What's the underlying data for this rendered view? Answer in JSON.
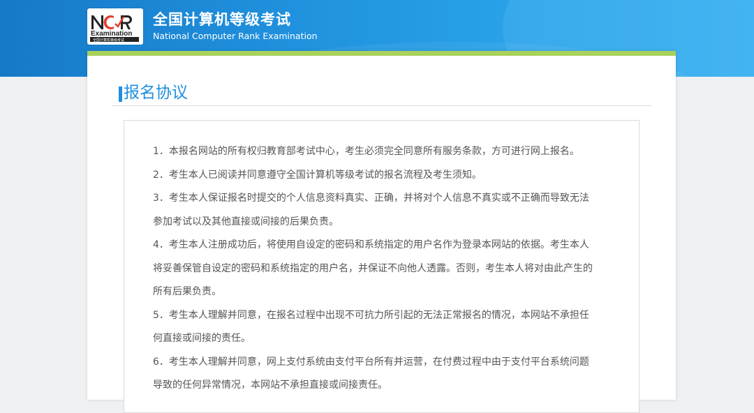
{
  "header": {
    "logo_text_top": "NCR",
    "logo_text_mid": "Examination",
    "logo_text_bottom": "全国计算机等级考试",
    "title_cn": "全国计算机等级考试",
    "title_en": "National Computer Rank Examination"
  },
  "colors": {
    "band_blue": "#1f8fdc",
    "accent_green": "#a9d15c",
    "title_blue": "#1f8fe0",
    "logo_red": "#e23b2b",
    "text_gray": "#555555"
  },
  "page": {
    "section_title": "报名协议"
  },
  "agreement": {
    "lines": [
      "1．本报名网站的所有权归教育部考试中心，考生必须完全同意所有服务条款，方可进行网上报名。",
      "2．考生本人已阅读并同意遵守全国计算机等级考试的报名流程及考生须知。",
      "3．考生本人保证报名时提交的个人信息资料真实、正确，并将对个人信息不真实或不正确而导致无法",
      "参加考试以及其他直接或间接的后果负责。",
      "4．考生本人注册成功后，将使用自设定的密码和系统指定的用户名作为登录本网站的依据。考生本人",
      "将妥善保管自设定的密码和系统指定的用户名，并保证不向他人透露。否则，考生本人将对由此产生的",
      "所有后果负责。",
      "5．考生本人理解并同意，在报名过程中出现不可抗力所引起的无法正常报名的情况，本网站不承担任",
      "何直接或间接的责任。",
      "6．考生本人理解并同意，网上支付系统由支付平台所有并运营，在付费过程中由于支付平台系统问题",
      "导致的任何异常情况，本网站不承担直接或间接责任。"
    ]
  }
}
